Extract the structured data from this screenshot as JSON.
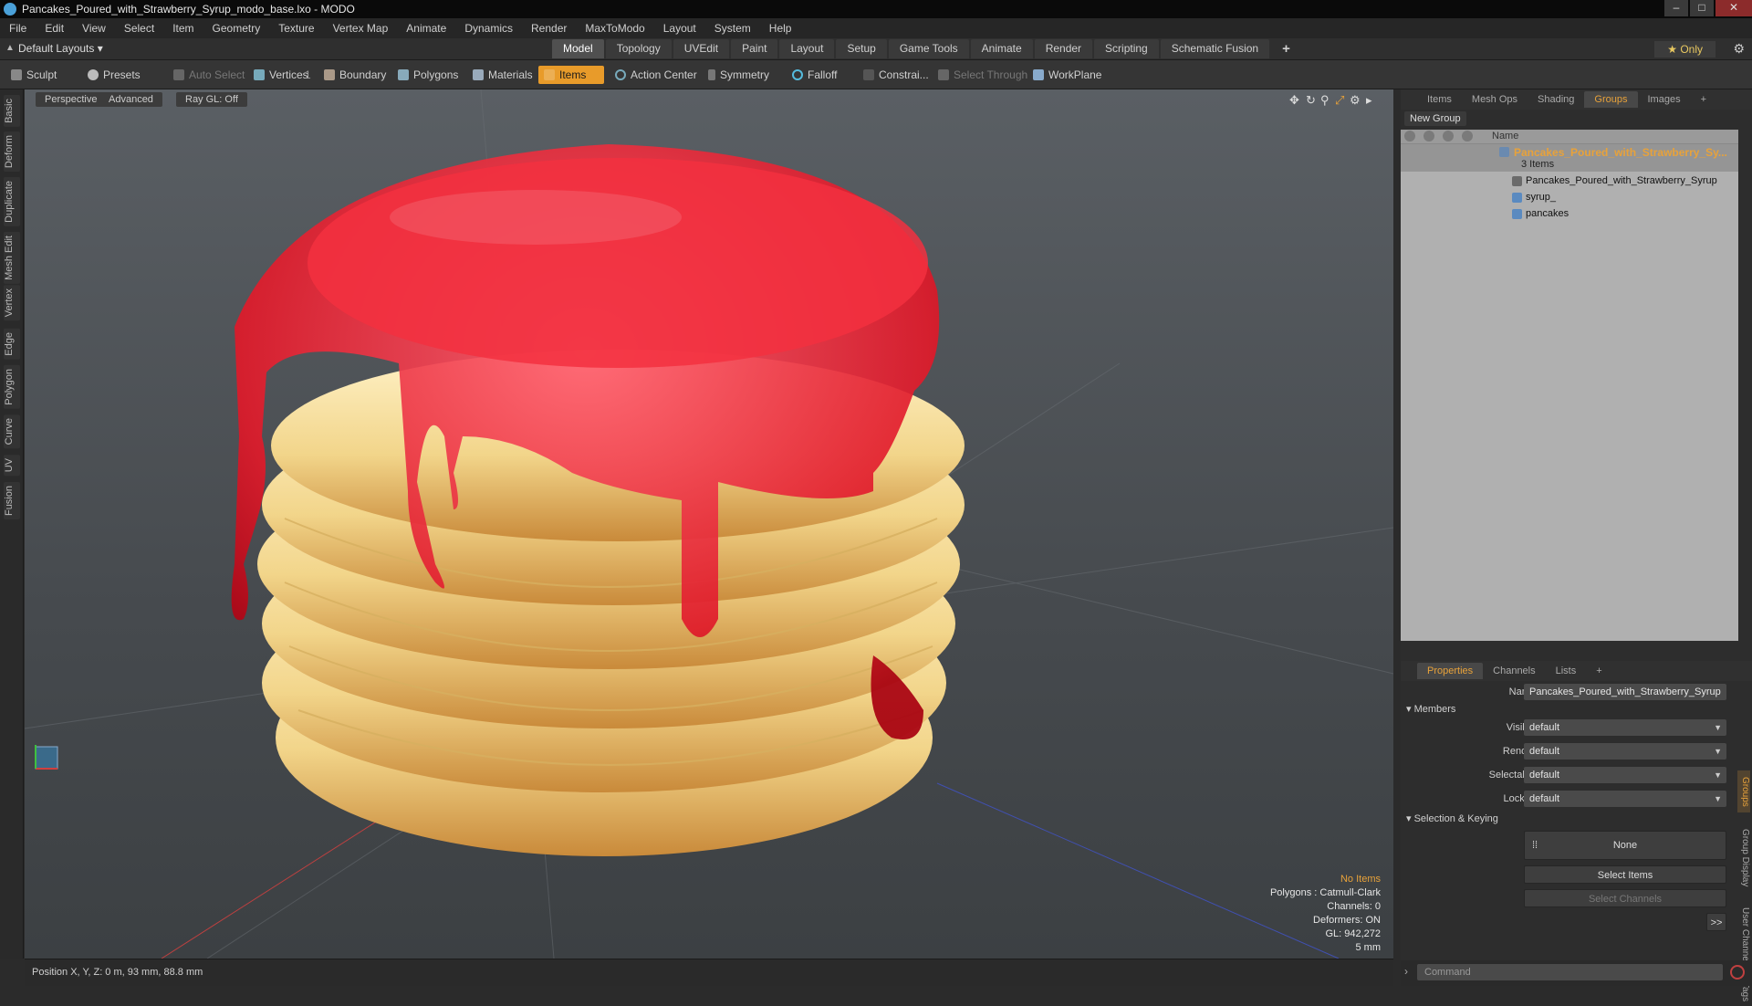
{
  "titlebar": {
    "title": "Pancakes_Poured_with_Strawberry_Syrup_modo_base.lxo - MODO"
  },
  "menu": [
    "File",
    "Edit",
    "View",
    "Select",
    "Item",
    "Geometry",
    "Texture",
    "Vertex Map",
    "Animate",
    "Dynamics",
    "Render",
    "MaxToModo",
    "Layout",
    "System",
    "Help"
  ],
  "layoutbar": {
    "layouts": "Default Layouts ▾",
    "tabs": [
      "Model",
      "Topology",
      "UVEdit",
      "Paint",
      "Layout",
      "Setup",
      "Game Tools",
      "Animate",
      "Render",
      "Scripting",
      "Schematic Fusion"
    ],
    "active_tab": "Model",
    "plus": "+",
    "only": "★ Only"
  },
  "toolbar": {
    "sculpt": "Sculpt",
    "presets": "Presets",
    "auto_select": "Auto Select",
    "vertices": "Vertices",
    "vertices_count": "1",
    "boundary": "Boundary",
    "polygons": "Polygons",
    "materials": "Materials",
    "items": "Items",
    "action_center": "Action Center",
    "symmetry": "Symmetry",
    "falloff": "Falloff",
    "constraints": "Constrai...",
    "select_through": "Select Through",
    "workplane": "WorkPlane"
  },
  "left_tabs": [
    "Basic",
    "Deform",
    "Duplicate",
    "Mesh Edit",
    "Vertex",
    "Edge",
    "Polygon",
    "Curve",
    "UV",
    "Fusion"
  ],
  "viewport": {
    "perspective": "Perspective",
    "advanced": "Advanced",
    "raygl": "Ray GL: Off",
    "stats": {
      "no_items": "No Items",
      "polygons": "Polygons : Catmull-Clark",
      "channels": "Channels: 0",
      "deformers": "Deformers: ON",
      "gl": "GL: 942,272",
      "unit": "5 mm"
    }
  },
  "statusbar": {
    "position": "Position X, Y, Z:  0 m, 93 mm, 88.8 mm"
  },
  "right_panel": {
    "top_tabs": [
      "Items",
      "Mesh Ops",
      "Shading",
      "Groups",
      "Images"
    ],
    "active_top_tab": "Groups",
    "plus": "+",
    "new_group": "New Group",
    "tree_header": "Name",
    "group_name": "Pancakes_Poured_with_Strawberry_Sy...",
    "group_count": "3 Items",
    "children": [
      "Pancakes_Poured_with_Strawberry_Syrup",
      "syrup_",
      "pancakes"
    ],
    "bottom_tabs": [
      "Properties",
      "Channels",
      "Lists"
    ],
    "active_bottom_tab": "Properties",
    "props": {
      "name_label": "Name",
      "name_value": "Pancakes_Poured_with_Strawberry_Syrup",
      "members": "Members",
      "visible_label": "Visible",
      "visible_value": "default",
      "render_label": "Render",
      "render_value": "default",
      "selectable_label": "Selectable",
      "selectable_value": "default",
      "locked_label": "Locked",
      "locked_value": "default",
      "selection_keying": "Selection & Keying",
      "none_btn": "None",
      "select_items": "Select Items",
      "select_channels": "Select Channels",
      "more": ">>"
    },
    "side_tabs": [
      "Groups",
      "Group Display",
      "User Channels",
      "Tags"
    ]
  },
  "command": {
    "placeholder": "Command"
  }
}
